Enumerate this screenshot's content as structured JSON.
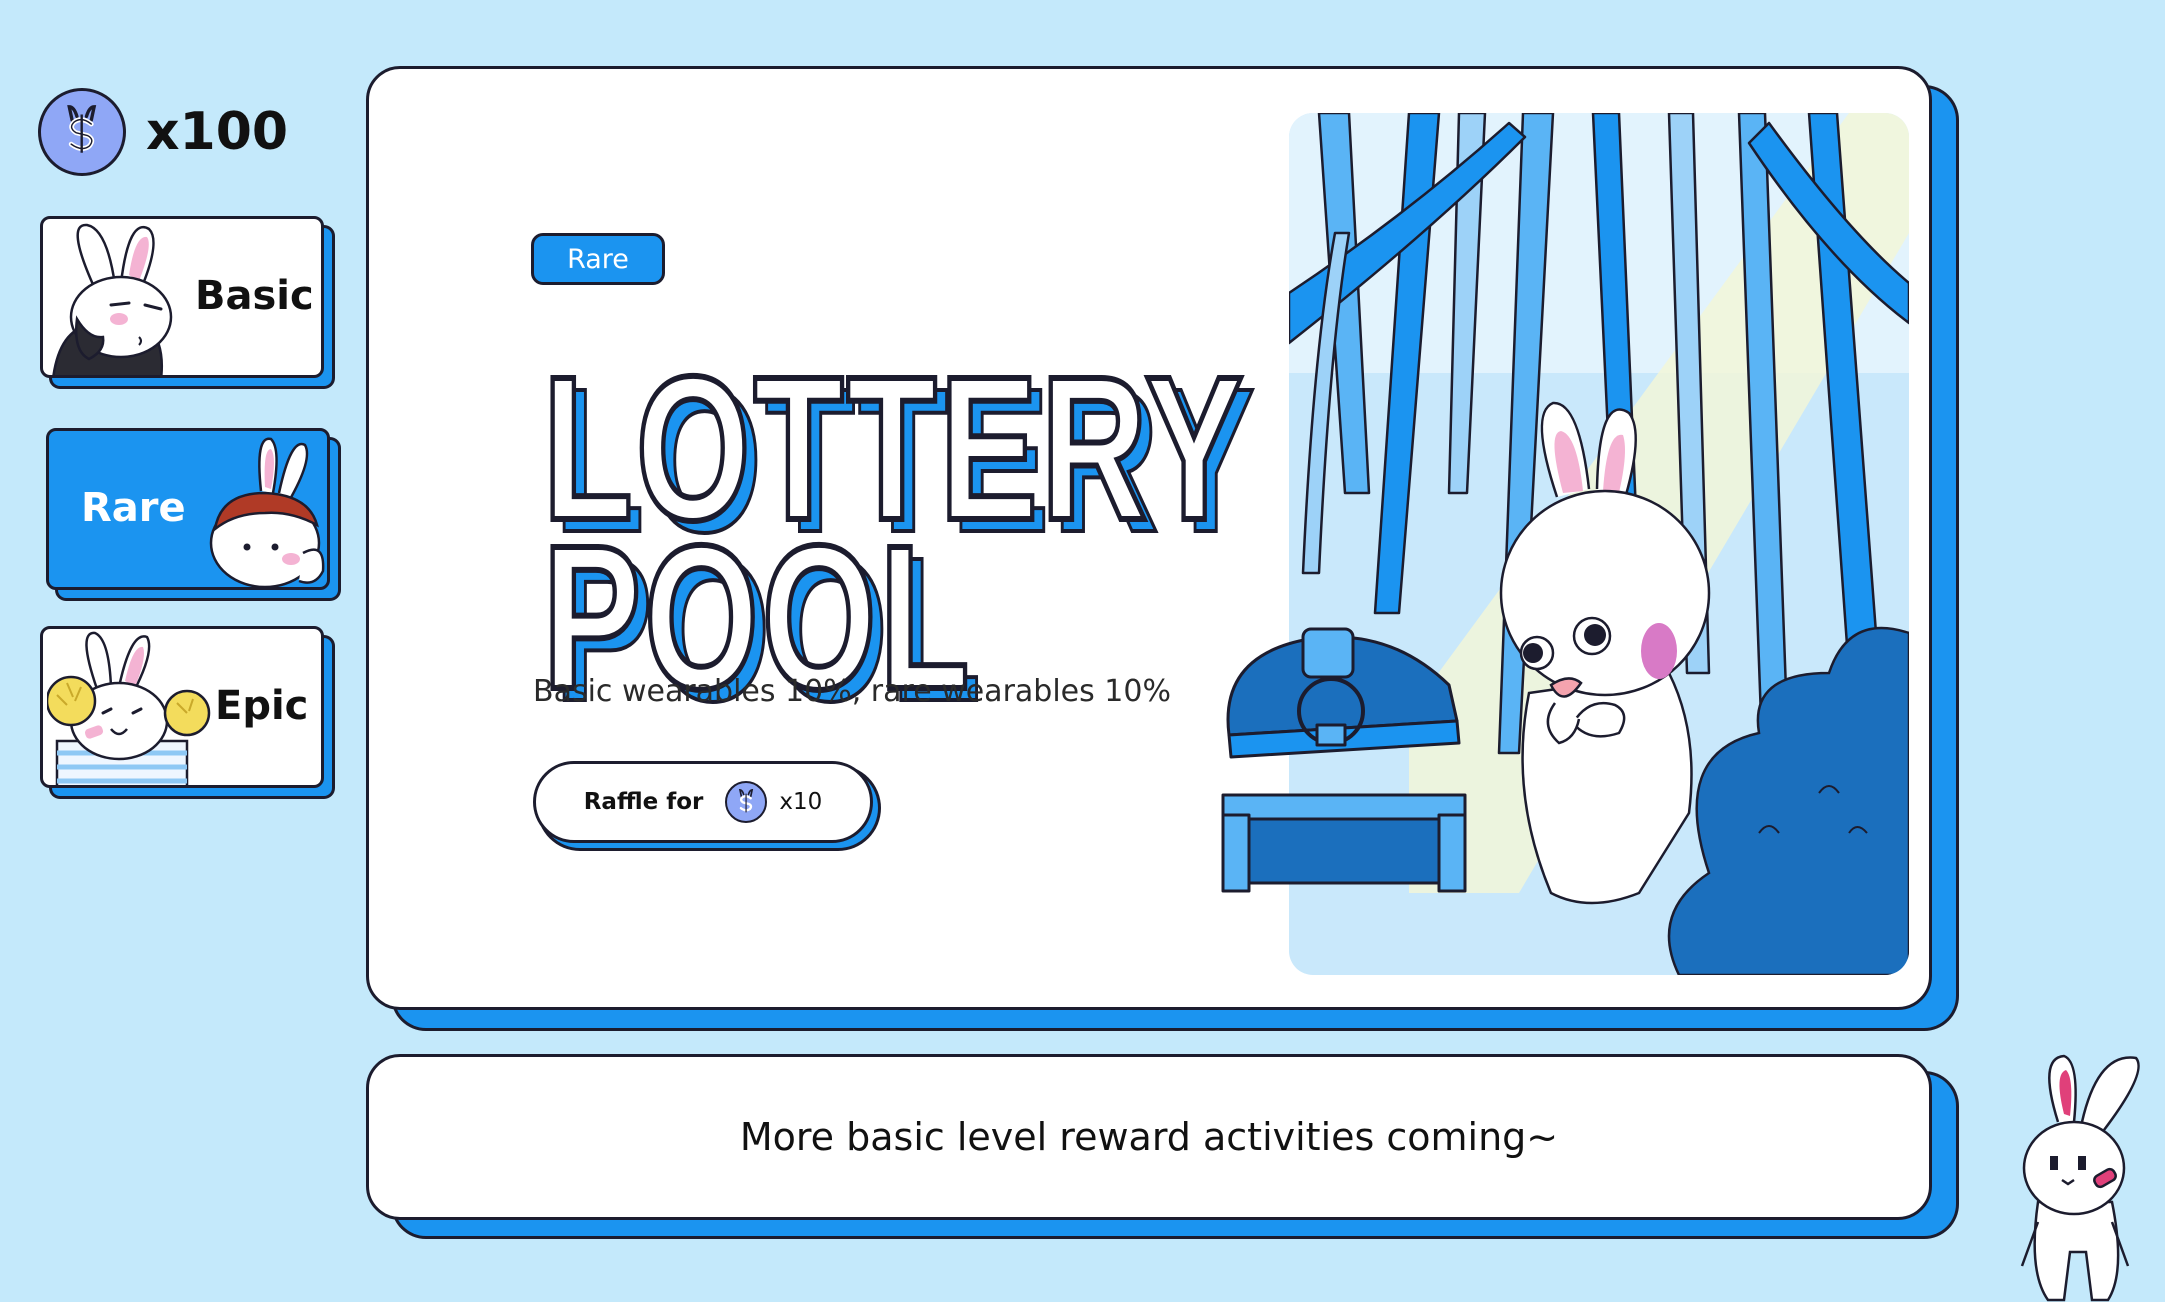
{
  "wallet": {
    "coin_icon": "bunny-coin-icon",
    "balance_label": "x100"
  },
  "tiers": [
    {
      "label": "Basic",
      "active": false
    },
    {
      "label": "Rare",
      "active": true
    },
    {
      "label": "Epic",
      "active": false
    }
  ],
  "pool": {
    "badge": "Rare",
    "title_line1": "LOTTERY",
    "title_line2": "POOL",
    "description": "Basic wearables 10%, rare wearables 10%",
    "raffle_label": "Raffle for",
    "raffle_cost": "x10"
  },
  "banner": {
    "text": "More basic level reward activities coming~"
  },
  "colors": {
    "background": "#c4e9fb",
    "accent": "#1b94f0",
    "accent_dark": "#1a6fbd",
    "outline": "#1c1c2e",
    "coin": "#8fa7f6",
    "blush": "#f4b3d3"
  }
}
